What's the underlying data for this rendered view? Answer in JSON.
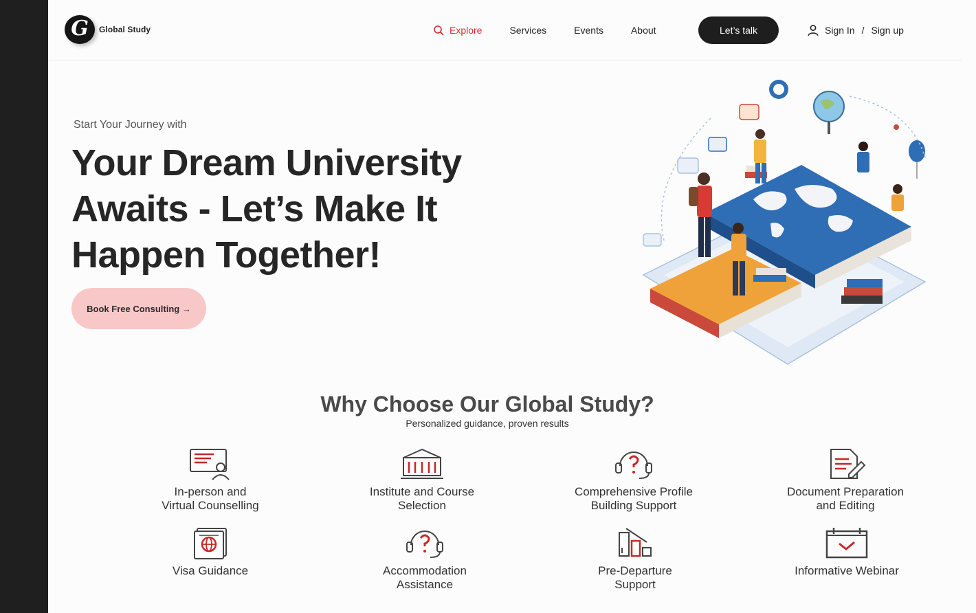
{
  "brand": {
    "name": "Global Study",
    "logo_glyph": "G"
  },
  "nav": {
    "items": [
      {
        "label": "Explore",
        "icon": "search-icon",
        "active": true
      },
      {
        "label": "Services"
      },
      {
        "label": "Events"
      },
      {
        "label": "About"
      }
    ],
    "cta_label": "Let’s talk",
    "signin_label": "Sign In",
    "signin_sep": "/",
    "signup_label": "Sign up"
  },
  "hero": {
    "kicker": "Start Your Journey with",
    "title": "Your Dream University Awaits - Let’s Make It Happen Together!",
    "button_label": "Book Free Consulting →"
  },
  "why": {
    "title": "Why Choose Our  Global Study?",
    "subtitle": "Personalized guidance, proven results",
    "features": [
      {
        "label": "In-person and\nVirtual Counselling",
        "icon": "counselling-icon"
      },
      {
        "label": "Institute and Course\nSelection",
        "icon": "institute-icon"
      },
      {
        "label": "Comprehensive Profile\nBuilding Support",
        "icon": "profile-support-icon"
      },
      {
        "label": "Document Preparation\nand Editing",
        "icon": "document-edit-icon"
      },
      {
        "label": "Visa Guidance",
        "icon": "visa-icon"
      },
      {
        "label": "Accommodation\nAssistance",
        "icon": "accommodation-icon"
      },
      {
        "label": "Pre-Departure\nSupport",
        "icon": "pre-departure-icon"
      },
      {
        "label": "Informative Webinar",
        "icon": "webinar-icon"
      }
    ]
  },
  "colors": {
    "accent": "#d32b2b",
    "dark": "#1e1e1e",
    "pink": "#f8c8c8",
    "blue": "#2f6db5",
    "orange": "#f0a23a"
  }
}
